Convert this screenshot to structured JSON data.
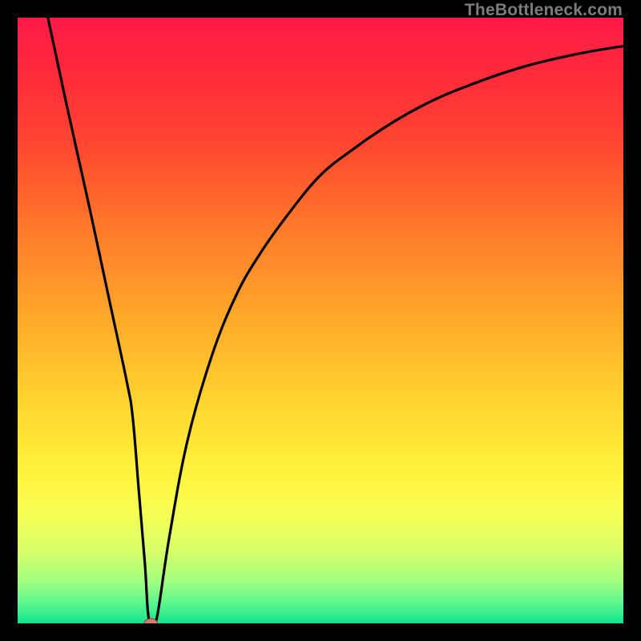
{
  "watermark": "TheBottleneck.com",
  "colors": {
    "gradient_stops": [
      {
        "stop": 0.0,
        "color": "#ff1a47"
      },
      {
        "stop": 0.1,
        "color": "#ff2b3a"
      },
      {
        "stop": 0.22,
        "color": "#ff4a2f"
      },
      {
        "stop": 0.35,
        "color": "#ff7a2a"
      },
      {
        "stop": 0.5,
        "color": "#ffaa2a"
      },
      {
        "stop": 0.65,
        "color": "#ffd92f"
      },
      {
        "stop": 0.75,
        "color": "#fff23a"
      },
      {
        "stop": 0.82,
        "color": "#f7ff55"
      },
      {
        "stop": 0.88,
        "color": "#d7ff6a"
      },
      {
        "stop": 0.93,
        "color": "#a3ff80"
      },
      {
        "stop": 0.97,
        "color": "#55f590"
      },
      {
        "stop": 1.0,
        "color": "#12e38a"
      }
    ],
    "curve": "#000000",
    "marker_fill": "#d87a6c",
    "marker_stroke": "#8c3a30"
  },
  "chart_data": {
    "type": "line",
    "title": "",
    "xlabel": "",
    "ylabel": "",
    "xlim": [
      0,
      100
    ],
    "ylim": [
      0,
      100
    ],
    "grid": false,
    "legend": false,
    "series": [
      {
        "name": "bottleneck-curve",
        "x": [
          5,
          8,
          12,
          15,
          18,
          19,
          20,
          21,
          21.5,
          22,
          23,
          25,
          28,
          32,
          36,
          40,
          45,
          50,
          55,
          60,
          65,
          70,
          75,
          80,
          85,
          90,
          95,
          100
        ],
        "y": [
          100,
          86,
          68,
          54,
          40,
          34,
          22,
          10,
          2,
          0,
          1,
          14,
          30,
          44,
          54,
          61,
          68,
          74,
          78,
          81.5,
          84.5,
          87,
          89,
          90.8,
          92.3,
          93.5,
          94.5,
          95.3
        ]
      }
    ],
    "marker": {
      "x": 22,
      "y": 0,
      "rx": 1.1,
      "ry": 0.8
    }
  }
}
